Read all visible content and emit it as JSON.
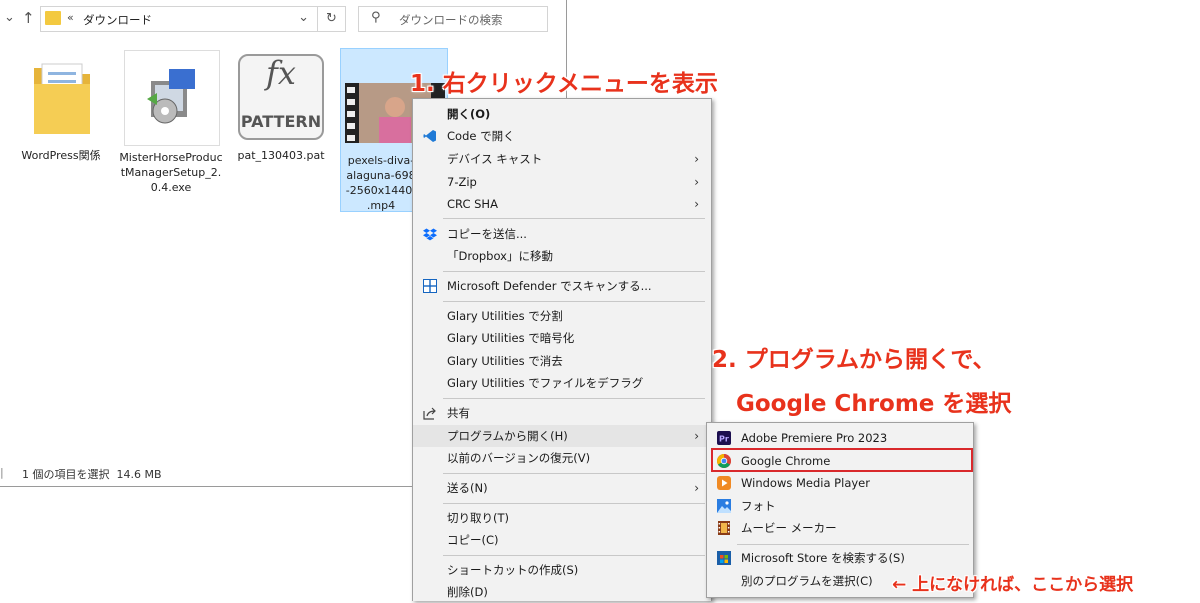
{
  "explorer": {
    "address_path": "ダウンロード",
    "address_prefix": "«",
    "search_placeholder": "ダウンロードの検索",
    "files": [
      {
        "name": "WordPress関係"
      },
      {
        "name": "MisterHorseProductManagerSetup_2.0.4.exe"
      },
      {
        "name": "pat_130403.pat",
        "thumb_text": "PATTERN",
        "thumb_glyph": "fx"
      },
      {
        "name": "pexels-diva-alaguna-698 -2560x1440- .mp4"
      }
    ],
    "status": "1 個の項目を選択  14.6 MB",
    "status_left": "|"
  },
  "context_menu": {
    "items": [
      {
        "label": "開く(O)",
        "bold": true
      },
      {
        "label": "Code で開く",
        "icon": "vscode-icon"
      },
      {
        "label": "デバイス キャスト",
        "submenu": true
      },
      {
        "label": "7-Zip",
        "submenu": true
      },
      {
        "label": "CRC SHA",
        "submenu": true
      },
      {
        "label": "コピーを送信...",
        "icon": "dropbox-icon"
      },
      {
        "label": "「Dropbox」に移動"
      },
      {
        "label": "Microsoft Defender でスキャンする...",
        "icon": "defender-icon"
      },
      {
        "label": "Glary Utilities で分割"
      },
      {
        "label": "Glary Utilities で暗号化"
      },
      {
        "label": "Glary Utilities で消去"
      },
      {
        "label": "Glary Utilities でファイルをデフラグ"
      },
      {
        "label": "共有",
        "icon": "share-icon"
      },
      {
        "label": "プログラムから開く(H)",
        "submenu": true
      },
      {
        "label": "以前のバージョンの復元(V)"
      },
      {
        "label": "送る(N)",
        "submenu": true
      },
      {
        "label": "切り取り(T)"
      },
      {
        "label": "コピー(C)"
      },
      {
        "label": "ショートカットの作成(S)"
      },
      {
        "label": "削除(D)"
      }
    ]
  },
  "open_with_menu": {
    "items": [
      {
        "label": "Adobe Premiere Pro 2023",
        "icon": "premiere-icon"
      },
      {
        "label": "Google Chrome",
        "icon": "chrome-icon"
      },
      {
        "label": "Windows Media Player",
        "icon": "media-player-icon"
      },
      {
        "label": "フォト",
        "icon": "photos-icon"
      },
      {
        "label": "ムービー メーカー",
        "icon": "movie-maker-icon"
      },
      {
        "label": "Microsoft Store を検索する(S)",
        "icon": "store-icon"
      },
      {
        "label": "別のプログラムを選択(C)"
      }
    ]
  },
  "annotations": {
    "step1": "1. 右クリックメニューを表示",
    "step2_line1": "2. プログラムから開くで、",
    "step2_line2": "Google Chrome を選択",
    "step3": "← 上になければ、ここから選択"
  },
  "colors": {
    "annotation_red": "#e8321c",
    "selection_blue": "#cce8ff",
    "chrome_highlight_border": "#d9292c",
    "menu_bg": "#f2f2f2"
  }
}
